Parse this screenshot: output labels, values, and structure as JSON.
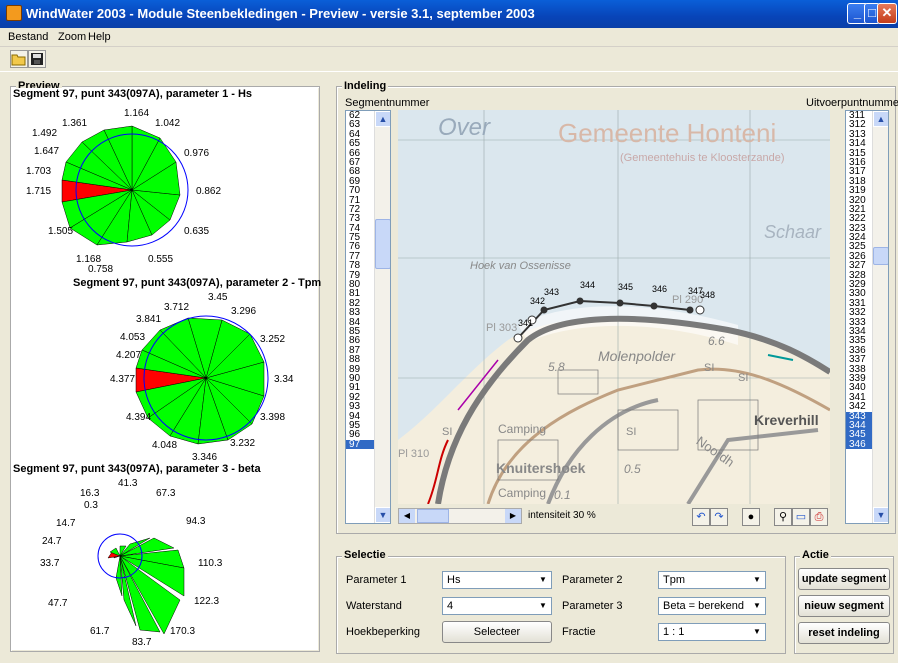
{
  "window": {
    "title": "WindWater 2003 - Module Steenbekledingen - Preview - versie 3.1, september 2003"
  },
  "menu": [
    "Bestand",
    "Zoom",
    "Help"
  ],
  "toolbar": {
    "open_icon": "folder-open-icon",
    "save_icon": "floppy-disk-icon"
  },
  "preview": {
    "label": "Preview",
    "roses": [
      {
        "title": "Segment 97, punt 343(097A), parameter 1 - Hs",
        "labels": [
          "1.164",
          "1.042",
          "0.976",
          "0.862",
          "0.635",
          "0.555",
          "0.758",
          "1.168",
          "1.505",
          "1.715",
          "1.703",
          "1.647",
          "1.492",
          "1.361"
        ]
      },
      {
        "title": "Segment 97, punt 343(097A), parameter 2 - Tpm",
        "labels": [
          "3.45",
          "3.296",
          "3.252",
          "3.34",
          "3.398",
          "3.232",
          "3.346",
          "4.048",
          "4.394",
          "4.377",
          "4.207",
          "4.053",
          "3.841",
          "3.712"
        ]
      },
      {
        "title": "Segment 97, punt 343(097A), parameter 3 - beta",
        "labels": [
          "41.3",
          "67.3",
          "94.3",
          "110.3",
          "122.3",
          "170.3",
          "83.7",
          "61.7",
          "47.7",
          "33.7",
          "24.7",
          "14.7",
          "0.3",
          "16.3"
        ]
      }
    ]
  },
  "indeling": {
    "label": "Indeling",
    "segment_header": "Segmentnummer",
    "point_header": "Uitvoerpuntnummer",
    "segments": [
      "62",
      "63",
      "64",
      "65",
      "66",
      "67",
      "68",
      "69",
      "70",
      "71",
      "72",
      "73",
      "74",
      "75",
      "76",
      "77",
      "78",
      "79",
      "80",
      "81",
      "82",
      "83",
      "84",
      "85",
      "86",
      "87",
      "88",
      "89",
      "90",
      "91",
      "92",
      "93",
      "94",
      "95",
      "96",
      "97"
    ],
    "selected_segment": "97",
    "points": [
      "311",
      "312",
      "313",
      "314",
      "315",
      "316",
      "317",
      "318",
      "319",
      "320",
      "321",
      "322",
      "323",
      "324",
      "325",
      "326",
      "327",
      "328",
      "329",
      "330",
      "331",
      "332",
      "333",
      "334",
      "335",
      "336",
      "337",
      "338",
      "339",
      "340",
      "341",
      "342",
      "343",
      "344",
      "345",
      "346"
    ],
    "selected_points": [
      "343",
      "344",
      "345",
      "346"
    ],
    "intensity_label": "intensiteit 30 %",
    "map_labels": {
      "municipality": "Gemeente Honteni",
      "municipality_sub": "(Gemeentehuis te Kloosterzande)",
      "water": "Over",
      "schaar": "Schaar",
      "hoek": "Hoek van Ossenisse",
      "polder": "Molenpolder",
      "krever": "Kreverhill",
      "knuiter": "Knuitershoek",
      "camping1": "Camping",
      "camping2": "Camping",
      "noord": "Noordh",
      "v58": "5.8",
      "v66": "6.6",
      "v05": "0.5",
      "v01": "0.1",
      "si1": "SI",
      "si2": "SI",
      "si3": "SI",
      "si4": "SI",
      "pl290": "Pl 290",
      "pl303": "Pl 303",
      "pl310": "Pl 310",
      "p341": "341",
      "p342": "342",
      "p343": "343",
      "p344": "344",
      "p345": "345",
      "p346": "346",
      "p347": "347",
      "p348": "348"
    }
  },
  "selectie": {
    "label": "Selectie",
    "param1_label": "Parameter 1",
    "param1_value": "Hs",
    "param2_label": "Parameter 2",
    "param2_value": "Tpm",
    "waterstand_label": "Waterstand",
    "waterstand_value": "4",
    "param3_label": "Parameter 3",
    "param3_value": "Beta = berekend",
    "hoek_label": "Hoekbeperking",
    "selecteer_button": "Selecteer",
    "fractie_label": "Fractie",
    "fractie_value": "1 : 1"
  },
  "actie": {
    "label": "Actie",
    "update_button": "update segment",
    "nieuw_button": "nieuw segment",
    "reset_button": "reset indeling"
  },
  "colors": {
    "rose_green": "#00ff00",
    "rose_red": "#ff0000",
    "circle": "#0000ff",
    "selection": "#316ac5"
  }
}
